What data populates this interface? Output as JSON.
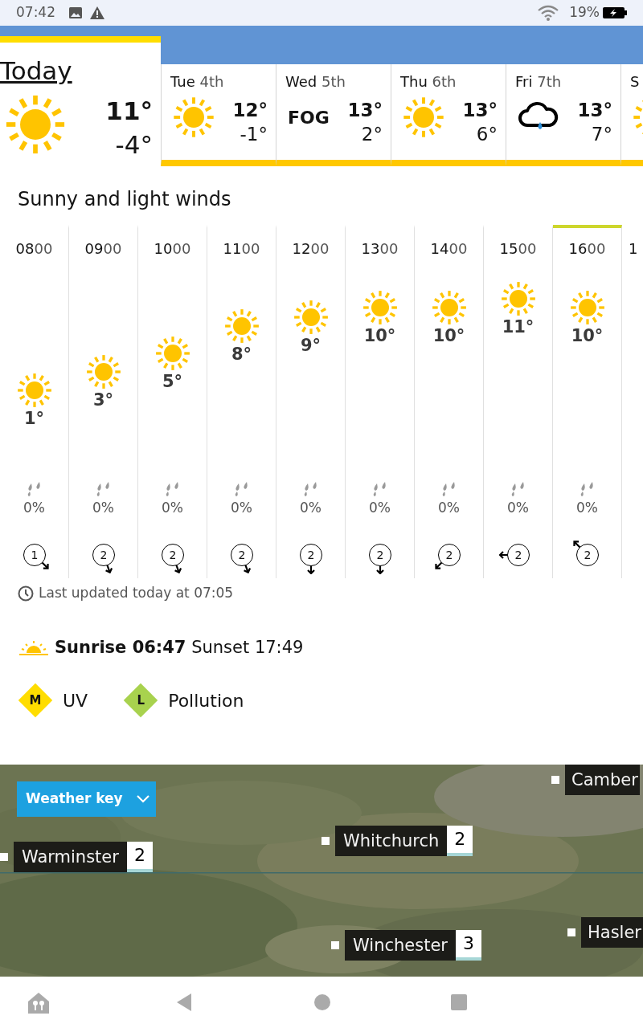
{
  "status_bar": {
    "time": "07:42",
    "battery": "19%"
  },
  "days": [
    {
      "day": "Today",
      "kind": "sunny",
      "high": "11°",
      "low": "-4°",
      "selected": true
    },
    {
      "day": "Tue",
      "date": "4th",
      "kind": "sunny",
      "high": "12°",
      "low": "-1°",
      "selected": false
    },
    {
      "day": "Wed",
      "date": "5th",
      "kind": "fog",
      "label": "FOG",
      "high": "13°",
      "low": "2°",
      "selected": false
    },
    {
      "day": "Thu",
      "date": "6th",
      "kind": "sunny",
      "high": "13°",
      "low": "6°",
      "selected": false
    },
    {
      "day": "Fri",
      "date": "7th",
      "kind": "rain",
      "high": "13°",
      "low": "7°",
      "selected": false
    },
    {
      "day": "S",
      "kind": "sunny",
      "selected": false
    }
  ],
  "summary": "Sunny and light winds",
  "hours": [
    {
      "hour": "08",
      "minutes": "00",
      "temp": "1°",
      "rain": "0%",
      "wind": "1",
      "kind": "se",
      "selected": false
    },
    {
      "hour": "09",
      "minutes": "00",
      "temp": "3°",
      "rain": "0%",
      "wind": "2",
      "kind": "sse",
      "selected": false
    },
    {
      "hour": "10",
      "minutes": "00",
      "temp": "5°",
      "rain": "0%",
      "wind": "2",
      "kind": "sse",
      "selected": false
    },
    {
      "hour": "11",
      "minutes": "00",
      "temp": "8°",
      "rain": "0%",
      "wind": "2",
      "kind": "sse",
      "selected": false
    },
    {
      "hour": "12",
      "minutes": "00",
      "temp": "9°",
      "rain": "0%",
      "wind": "2",
      "kind": "s",
      "selected": false
    },
    {
      "hour": "13",
      "minutes": "00",
      "temp": "10°",
      "rain": "0%",
      "wind": "2",
      "kind": "s",
      "selected": false
    },
    {
      "hour": "14",
      "minutes": "00",
      "temp": "10°",
      "rain": "0%",
      "wind": "2",
      "kind": "sw",
      "selected": false
    },
    {
      "hour": "15",
      "minutes": "00",
      "temp": "11°",
      "rain": "0%",
      "wind": "2",
      "kind": "w",
      "selected": false
    },
    {
      "hour": "16",
      "minutes": "00",
      "temp": "10°",
      "rain": "0%",
      "wind": "2",
      "kind": "nw",
      "selected": true
    },
    {
      "hour": "1",
      "selected": false
    }
  ],
  "last_updated": "Last updated today at 07:05",
  "sun_times": "**Sunrise 06:47** Sunset 17:49",
  "indices": [
    {
      "level_letter": "M",
      "label": "UV",
      "color": "#ffdd00"
    },
    {
      "level_letter": "L",
      "label": "Pollution",
      "color": "#a8d24e"
    }
  ],
  "map": {
    "weather_key": "Weather key",
    "places": [
      {
        "name": "Camber"
      },
      {
        "name": "Whitchurch",
        "uv": "2"
      },
      {
        "name": "Warminster",
        "uv": "2"
      },
      {
        "name": "Hasler"
      },
      {
        "name": "Winchester",
        "uv": "3"
      }
    ]
  }
}
